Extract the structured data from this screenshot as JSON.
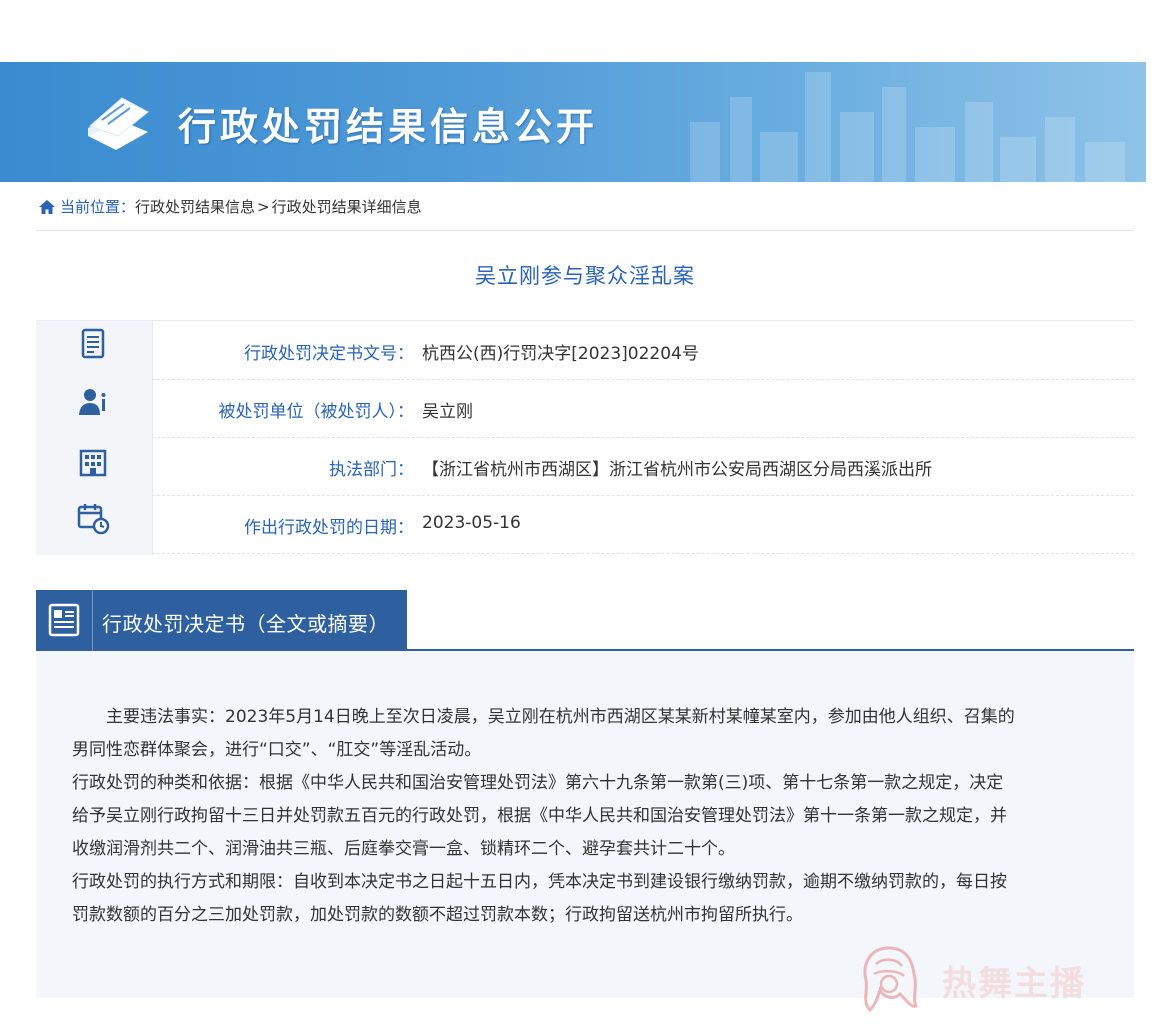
{
  "banner": {
    "title": "行政处罚结果信息公开"
  },
  "breadcrumb": {
    "prefix": "当前位置：",
    "item1": "行政处罚结果信息",
    "sep": ">",
    "item2": "行政处罚结果详细信息"
  },
  "case_title": "吴立刚参与聚众淫乱案",
  "info": [
    {
      "icon": "document-list-icon",
      "label": "行政处罚决定书文号：",
      "value": "杭西公(西)行罚决字[2023]02204号"
    },
    {
      "icon": "person-info-icon",
      "label": "被处罚单位（被处罚人）：",
      "value": "吴立刚"
    },
    {
      "icon": "building-icon",
      "label": "执法部门：",
      "value": "【浙江省杭州市西湖区】浙江省杭州市公安局西湖区分局西溪派出所"
    },
    {
      "icon": "calendar-clock-icon",
      "label": "作出行政处罚的日期：",
      "value": "2023-05-16"
    }
  ],
  "section": {
    "title": "行政处罚决定书（全文或摘要）"
  },
  "content": {
    "p1_line1": "主要违法事实：2023年5月14日晚上至次日凌晨，吴立刚在杭州市西湖区某某新村某幢某室内，参加由他人组织、召集的",
    "p1_line2": "男同性恋群体聚会，进行“口交”、“肛交”等淫乱活动。",
    "p2_line1": "行政处罚的种类和依据：根据《中华人民共和国治安管理处罚法》第六十九条第一款第(三)项、第十七条第一款之规定，决定",
    "p2_line2": "给予吴立刚行政拘留十三日并处罚款五百元的行政处罚，根据《中华人民共和国治安管理处罚法》第十一条第一款之规定，并",
    "p2_line3": "收缴润滑剂共二个、润滑油共三瓶、后庭拳交膏一盒、锁精环二个、避孕套共计二十个。",
    "p3_line1": "行政处罚的执行方式和期限：自收到本决定书之日起十五日内，凭本决定书到建设银行缴纳罚款，逾期不缴纳罚款的，每日按",
    "p3_line2": "罚款数额的百分之三加处罚款，加处罚款的数额不超过罚款本数；行政拘留送杭州市拘留所执行。"
  },
  "watermark": {
    "text": "热舞主播"
  },
  "colors": {
    "accent": "#2a63b5",
    "header_bar": "#2e5f9e",
    "banner": "#4f9ad8"
  }
}
